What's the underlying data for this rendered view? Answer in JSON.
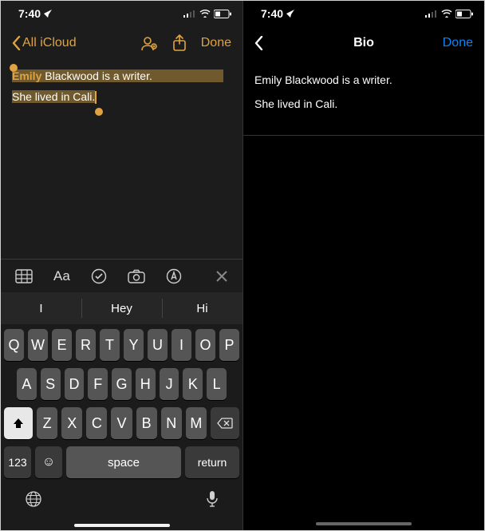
{
  "status": {
    "time": "7:40"
  },
  "left": {
    "back_label": "All iCloud",
    "done_label": "Done",
    "note": {
      "line1_bold": "Emily",
      "line1_rest": " Blackwood is a writer.",
      "line2": "She lived in Cali."
    },
    "toolbar": {
      "aa": "Aa"
    },
    "suggestions": [
      "I",
      "Hey",
      "Hi"
    ],
    "keyboard": {
      "row1": [
        "Q",
        "W",
        "E",
        "R",
        "T",
        "Y",
        "U",
        "I",
        "O",
        "P"
      ],
      "row2": [
        "A",
        "S",
        "D",
        "F",
        "G",
        "H",
        "J",
        "K",
        "L"
      ],
      "row3": [
        "Z",
        "X",
        "C",
        "V",
        "B",
        "N",
        "M"
      ],
      "num": "123",
      "space": "space",
      "return": "return"
    }
  },
  "right": {
    "title": "Bio",
    "done_label": "Done",
    "line1": "Emily Blackwood is a writer.",
    "line2": "She lived in Cali."
  }
}
